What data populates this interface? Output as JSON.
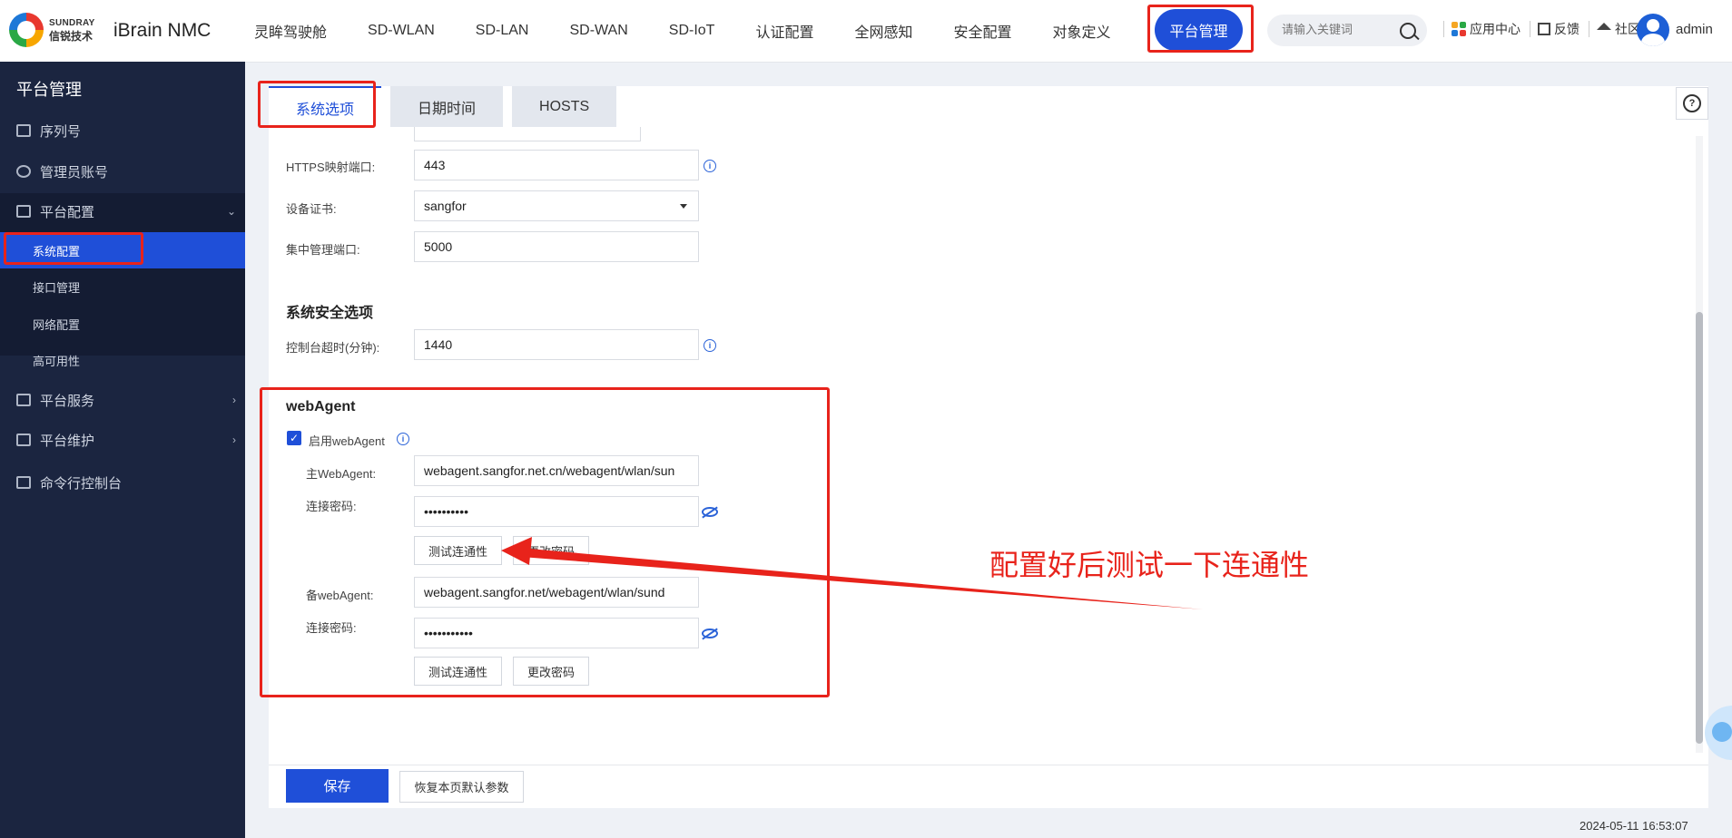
{
  "app": {
    "brand_en": "SUNDRAY",
    "brand_cn": "信锐技术",
    "product": "iBrain NMC"
  },
  "nav": {
    "items": [
      "灵眸驾驶舱",
      "SD-WLAN",
      "SD-LAN",
      "SD-WAN",
      "SD-IoT",
      "认证配置",
      "全网感知",
      "安全配置",
      "对象定义"
    ],
    "active": "平台管理"
  },
  "search": {
    "placeholder": "请输入关键词"
  },
  "tools": {
    "app_center": "应用中心",
    "feedback": "反馈",
    "community": "社区",
    "user": "admin"
  },
  "sidebar": {
    "title": "平台管理",
    "items": {
      "serial": "序列号",
      "admin_account": "管理员账号",
      "platform_config": "平台配置",
      "platform_service": "平台服务",
      "platform_maintenance": "平台维护",
      "cli": "命令行控制台"
    },
    "sub_items": {
      "system_config": "系统配置",
      "interface": "接口管理",
      "network": "网络配置",
      "ha": "高可用性"
    }
  },
  "tabs": {
    "system_options": "系统选项",
    "datetime": "日期时间",
    "hosts": "HOSTS"
  },
  "form": {
    "https_port_label": "HTTPS映射端口:",
    "https_port": "443",
    "cert_label": "设备证书:",
    "cert": "sangfor",
    "mgmt_port_label": "集中管理端口:",
    "mgmt_port": "5000",
    "security_title": "系统安全选项",
    "timeout_label": "控制台超时(分钟):",
    "timeout": "1440"
  },
  "webagent": {
    "title": "webAgent",
    "enable_label": "启用webAgent",
    "primary_label": "主WebAgent:",
    "primary_value": "webagent.sangfor.net.cn/webagent/wlan/sun",
    "primary_pwd_label": "连接密码:",
    "primary_pwd": "••••••••••",
    "test_label": "测试连通性",
    "change_pwd_label": "更改密码",
    "backup_label": "备webAgent:",
    "backup_value": "webagent.sangfor.net/webagent/wlan/sund",
    "backup_pwd_label": "连接密码:",
    "backup_pwd": "•••••••••••"
  },
  "annotation": "配置好后测试一下连通性",
  "footer": {
    "save": "保存",
    "reset": "恢复本页默认参数",
    "timestamp": "2024-05-11 16:53:07"
  },
  "colors": {
    "accent": "#1f4fd8",
    "highlight": "#e8231b",
    "sidebar": "#1b2540"
  }
}
